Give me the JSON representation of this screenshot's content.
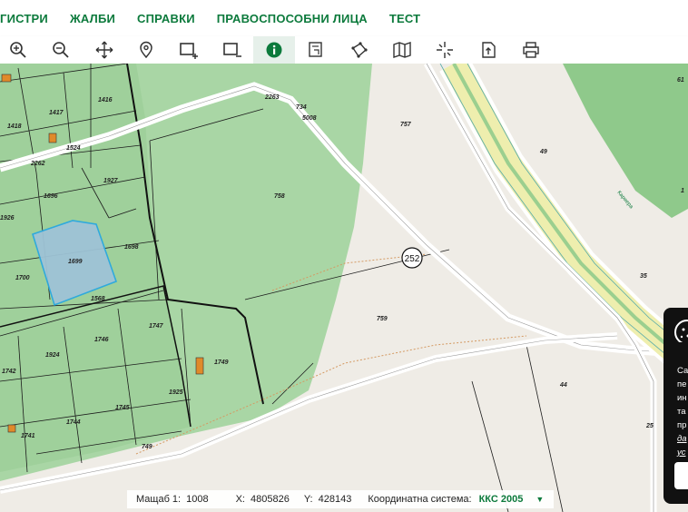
{
  "nav": {
    "items": [
      "ГИСТРИ",
      "ЖАЛБИ",
      "СПРАВКИ",
      "ПРАВОСПОСОБНИ ЛИЦА",
      "ТЕСТ"
    ]
  },
  "toolbar": {
    "tools": [
      "zoom-in-icon",
      "zoom-out-icon",
      "pan-icon",
      "location-pin-icon",
      "add-rect-icon",
      "remove-rect-icon",
      "info-icon",
      "document-layers-icon",
      "polygon-measure-icon",
      "map-icon",
      "crosshair-icon",
      "export-icon",
      "print-icon"
    ],
    "active": "info-icon"
  },
  "map": {
    "parcels": [
      "1416",
      "1417",
      "1418",
      "1524",
      "2262",
      "1696",
      "1927",
      "1926",
      "1698",
      "1699",
      "1700",
      "1568",
      "1747",
      "1746",
      "1924",
      "1742",
      "1749",
      "1925",
      "1745",
      "1744",
      "1741",
      "749",
      "2263",
      "734",
      "5008",
      "757",
      "758",
      "759",
      "49",
      "35",
      "44",
      "25",
      "61",
      "1"
    ],
    "road_marker": "252",
    "road_label": "Кариера"
  },
  "status": {
    "scale_label": "Мащаб 1:",
    "scale_value": "1008",
    "x_label": "X:",
    "x_value": "4805826",
    "y_label": "Y:",
    "y_value": "428143",
    "crs_label": "Координатна система:",
    "crs_value": "ККС 2005"
  },
  "side_panel": {
    "lines": [
      "Са",
      "пе",
      "ин",
      "та",
      "пр",
      "да",
      "ус"
    ]
  },
  "colors": {
    "brand": "#0c7a3c",
    "forest": "#a9d6a5",
    "selected": "#9ec3d6"
  }
}
